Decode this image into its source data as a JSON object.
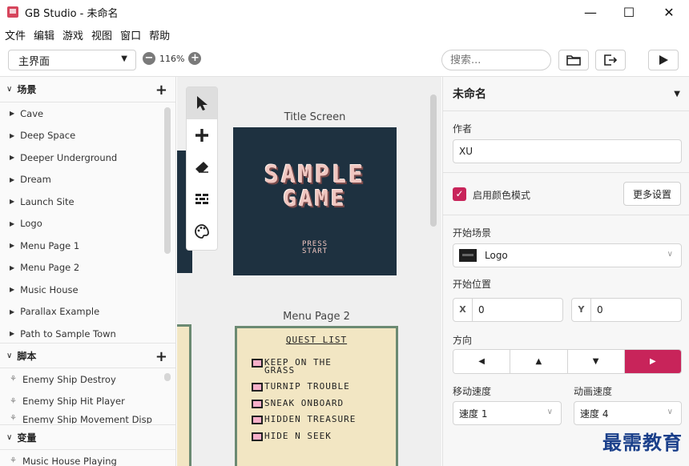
{
  "window": {
    "title": "GB Studio - 未命名",
    "minimize": "—",
    "maximize": "☐",
    "close": "✕"
  },
  "menu": [
    "文件",
    "编辑",
    "游戏",
    "视图",
    "窗口",
    "帮助"
  ],
  "toolbar": {
    "section_select": "主界面",
    "zoom_level": "116%",
    "zoom_out": "−",
    "zoom_in": "+",
    "search_placeholder": "搜索..."
  },
  "sidebar": {
    "scenes_header": "场景",
    "scenes": [
      "Cave",
      "Deep Space",
      "Deeper Underground",
      "Dream",
      "Launch Site",
      "Logo",
      "Menu Page 1",
      "Menu Page 2",
      "Music House",
      "Parallax Example",
      "Path to Sample Town"
    ],
    "scripts_header": "脚本",
    "scripts": [
      "Enemy Ship Destroy",
      "Enemy Ship Hit Player",
      "Enemy Ship Movement Disp"
    ],
    "variables_header": "变量",
    "variables": [
      "Music House Playing"
    ]
  },
  "canvas": {
    "scene1_name": "Title Screen",
    "scene1_line1": "SAMPLE",
    "scene1_line2": "GAME",
    "scene1_press": "PRESS",
    "scene1_start": "START",
    "scene2_name": "Menu Page 2",
    "scene2_title": "QUEST LIST",
    "quests": [
      [
        "KEEP ON THE",
        "GRASS"
      ],
      [
        "TURNIP TROUBLE"
      ],
      [
        "SNEAK ONBOARD"
      ],
      [
        "HIDDEN TREASURE"
      ],
      [
        "HIDE N SEEK"
      ]
    ]
  },
  "properties": {
    "project_name": "未命名",
    "author_label": "作者",
    "author_value": "XU",
    "color_mode_label": "启用颜色模式",
    "color_mode_checked": true,
    "more_settings": "更多设置",
    "start_scene_label": "开始场景",
    "start_scene_value": "Logo",
    "start_pos_label": "开始位置",
    "x_label": "X",
    "x_value": "0",
    "y_label": "Y",
    "y_value": "0",
    "direction_label": "方向",
    "direction_selected": "right",
    "move_speed_label": "移动速度",
    "move_speed_value": "速度 1",
    "anim_speed_label": "动画速度",
    "anim_speed_value": "速度 4"
  },
  "colors": {
    "accent": "#c8245a",
    "gb_dark": "#1e3140",
    "gb_paper": "#f2e6c3"
  },
  "watermark": "最需教育"
}
